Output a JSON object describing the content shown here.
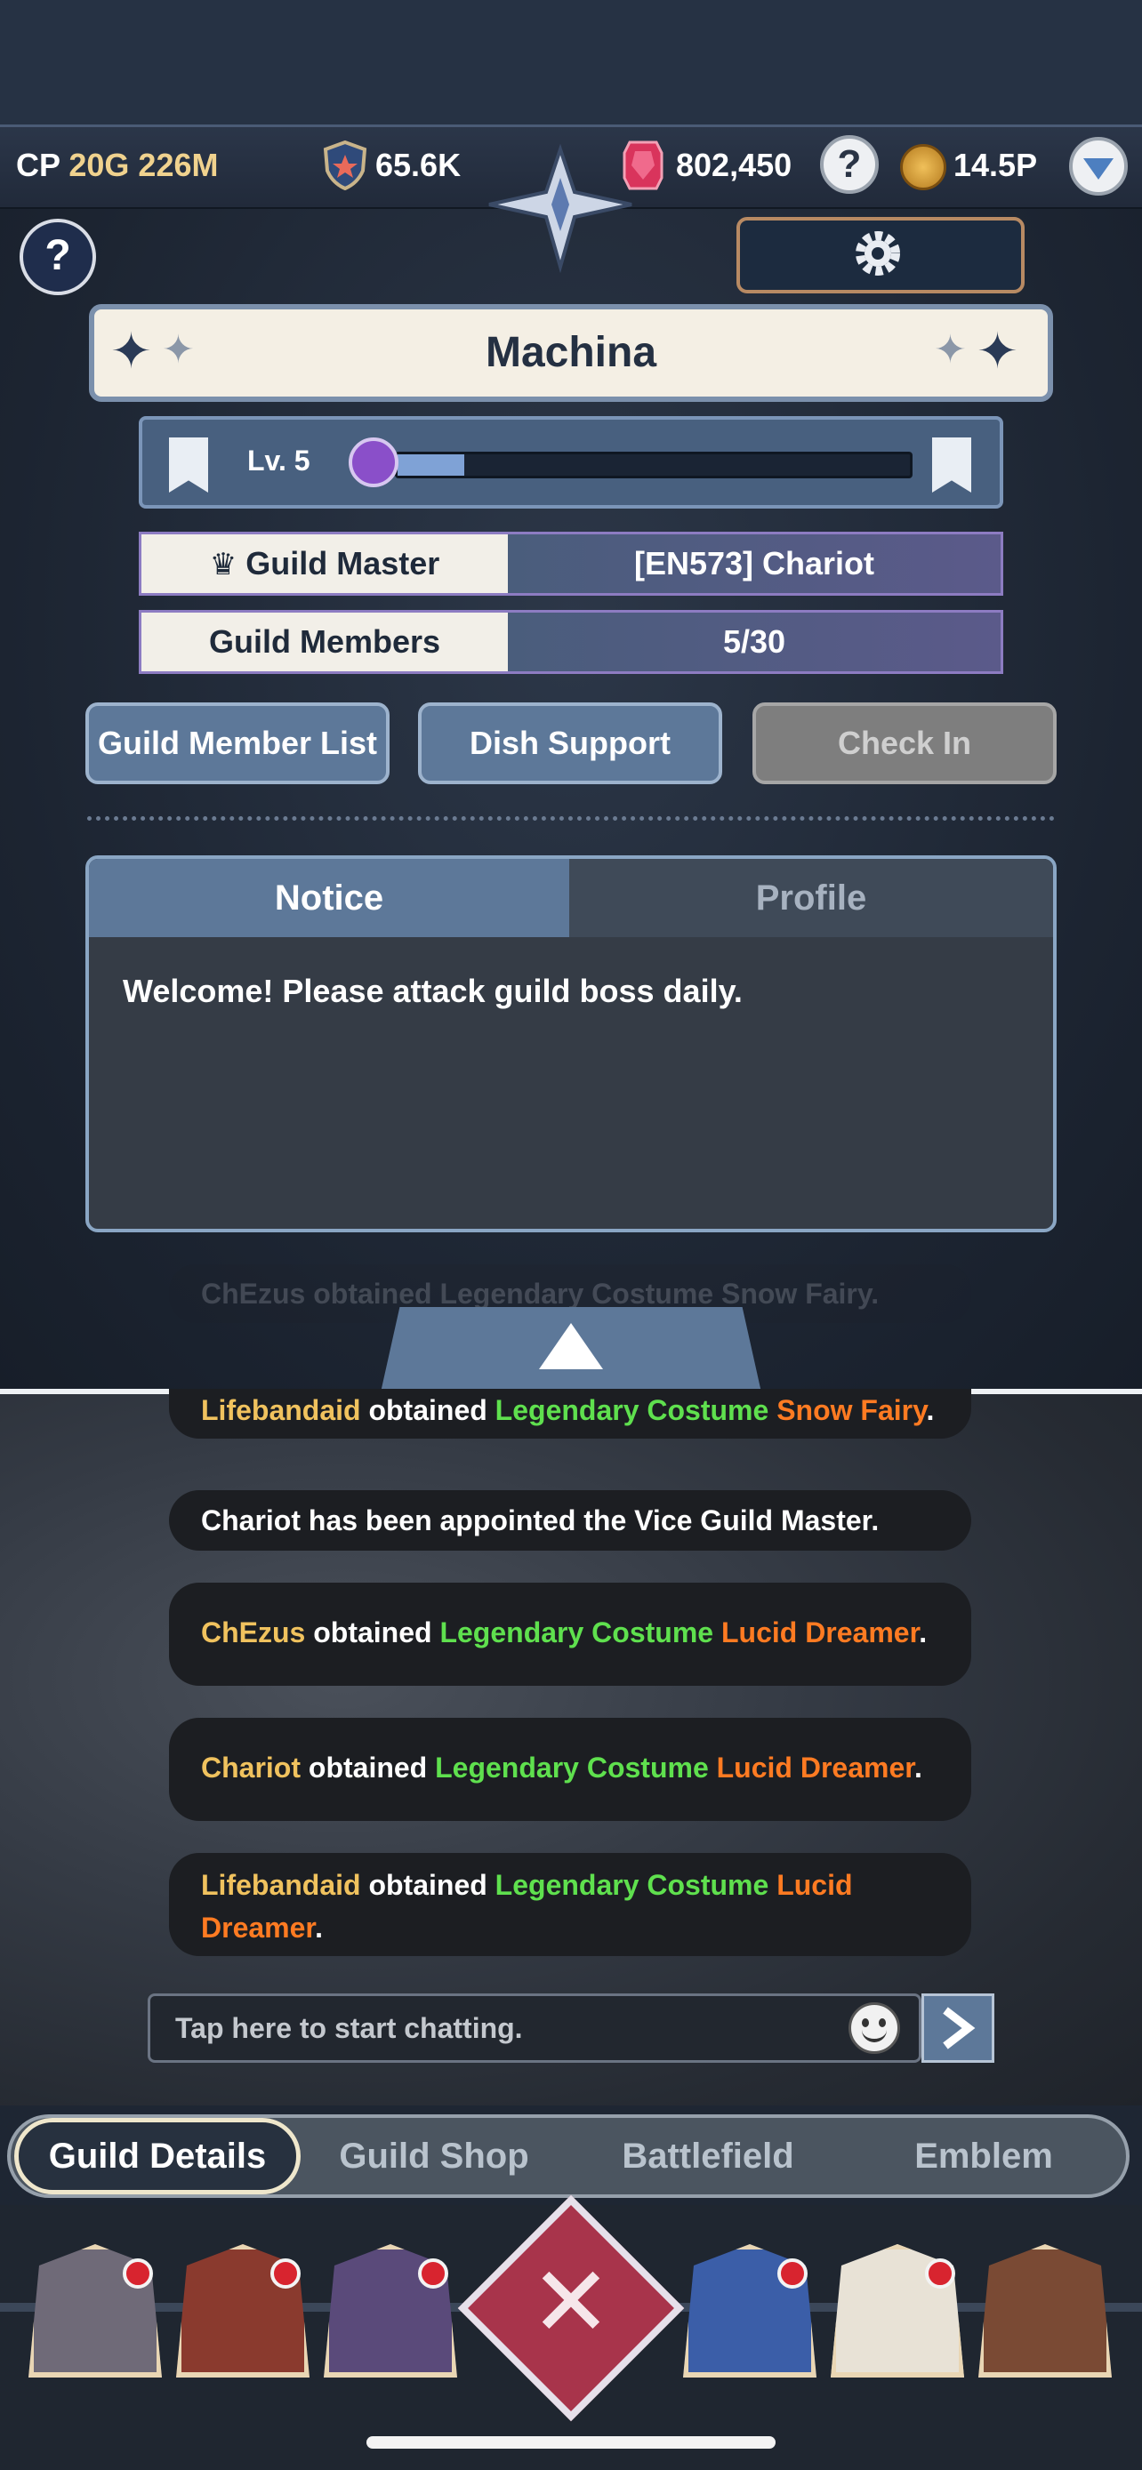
{
  "status": {
    "cp_label": "CP",
    "cp_value": "20G 226M",
    "shield_value": "65.6K",
    "gem_value": "802,450",
    "gold_value": "14.5P"
  },
  "guild": {
    "name": "Machina",
    "level_text": "Lv. 5",
    "level_progress": 0.13,
    "master_label": "Guild Master",
    "master_value": "[EN573] Chariot",
    "members_label": "Guild Members",
    "members_value": "5/30"
  },
  "actions": {
    "member_list": "Guild Member List",
    "dish_support": "Dish Support",
    "check_in": "Check In"
  },
  "notice": {
    "tab_notice": "Notice",
    "tab_profile": "Profile",
    "text": "Welcome! Please attack guild boss daily."
  },
  "chat": {
    "ghost_top": "ChEzus obtained Legendary Costume Snow Fairy.",
    "messages": [
      {
        "user": "Lifebandaid",
        "mid": " obtained ",
        "item": "Legendary Costume ",
        "name": "Snow Fairy",
        "end": "."
      },
      {
        "system": "Chariot has been appointed the Vice Guild Master."
      },
      {
        "user": "ChEzus",
        "mid": " obtained ",
        "item": "Legendary Costume ",
        "name": "Lucid Dreamer",
        "end": "."
      },
      {
        "user": "Chariot",
        "mid": " obtained ",
        "item": "Legendary Costume ",
        "name": "Lucid Dreamer",
        "end": "."
      },
      {
        "user": "Lifebandaid",
        "mid": " obtained ",
        "item": "Legendary Costume ",
        "name": "Lucid Dreamer",
        "end": "."
      }
    ],
    "input_placeholder": "Tap here to start chatting."
  },
  "tabs": [
    "Guild Details",
    "Guild Shop",
    "Battlefield",
    "Emblem"
  ],
  "colors": {
    "accent_blue": "#5d7899",
    "user_yellow": "#f0c25e",
    "item_green": "#5fe04e",
    "name_orange": "#ff7b22"
  }
}
